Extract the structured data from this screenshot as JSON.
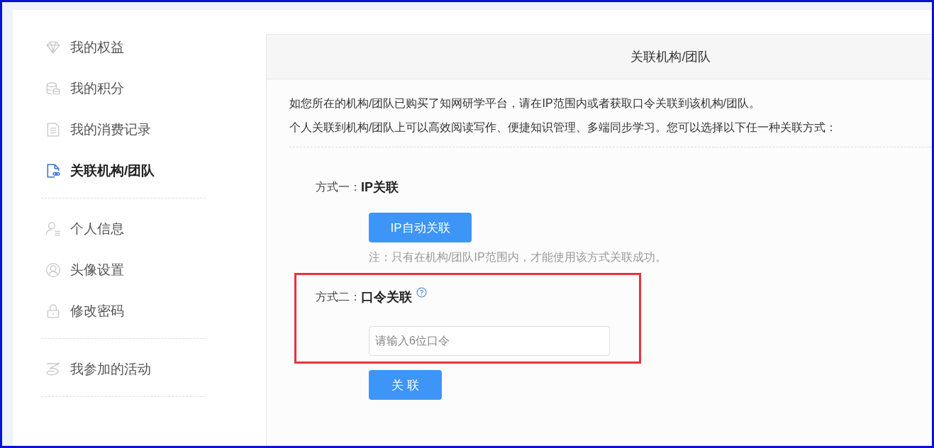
{
  "sidebar": {
    "groups": [
      [
        {
          "label": "我的权益",
          "kind": "diamond",
          "selected": false
        },
        {
          "label": "我的积分",
          "kind": "coins",
          "selected": false
        },
        {
          "label": "我的消费记录",
          "kind": "document",
          "selected": false
        },
        {
          "label": "关联机构/团队",
          "kind": "link-document",
          "selected": true
        }
      ],
      [
        {
          "label": "个人信息",
          "kind": "person",
          "selected": false
        },
        {
          "label": "头像设置",
          "kind": "avatar",
          "selected": false
        },
        {
          "label": "修改密码",
          "kind": "lock",
          "selected": false
        }
      ],
      [
        {
          "label": "我参加的活动",
          "kind": "flag",
          "selected": false
        }
      ]
    ]
  },
  "panel": {
    "title": "关联机构/团队",
    "intro": [
      "如您所在的机构/团队已购买了知网研学平台，请在IP范围内或者获取口令关联到该机构/团队。",
      "个人关联到机构/团队上可以高效阅读写作、便捷知识管理、多端同步学习。您可以选择以下任一种关联方式："
    ],
    "methods": [
      {
        "kind": "ip",
        "prefix": "方式一：",
        "name": "IP关联",
        "highlighted": false,
        "button": "IP自动关联",
        "note": "注：只有在机构/团队IP范围内，才能使用该方式关联成功。"
      },
      {
        "kind": "code",
        "prefix": "方式二：",
        "name": "口令关联",
        "highlighted": true,
        "help": true,
        "placeholder": "请输入6位口令",
        "button": "关 联"
      }
    ]
  }
}
